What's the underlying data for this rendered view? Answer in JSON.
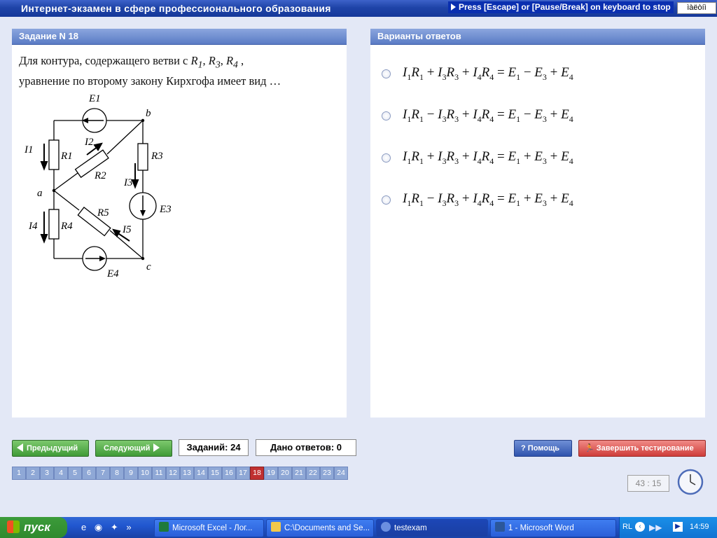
{
  "window": {
    "title": "Интернет-экзамен в сфере профессионального образования",
    "stop_hint": "Press [Escape] or [Pause/Break] on keyboard to stop",
    "lang_indicator": "ìàëòíì"
  },
  "task": {
    "header": "Задание N 18",
    "question_part1": "Для контура, содержащего ветви с",
    "question_part2": ",",
    "question_part3": "уравнение по второму закону Кирхгофа имеет вид …",
    "resistors": [
      "R1",
      "R3",
      "R4"
    ],
    "circuit_labels": {
      "E1": "E1",
      "b": "b",
      "I1": "I1",
      "R1": "R1",
      "I2": "I2",
      "R2": "R2",
      "R3": "R3",
      "I3": "I3",
      "a": "a",
      "E3": "E3",
      "R5": "R5",
      "I4": "I4",
      "R4": "R4",
      "I5": "I5",
      "c": "c",
      "E4": "E4"
    }
  },
  "answers": {
    "header": "Варианты ответов",
    "options": [
      {
        "formula": "I1R1 + I3R3 + I4R4 = E1 − E3 + E4",
        "selected": false
      },
      {
        "formula": "I1R1 − I3R3 + I4R4 = E1 − E3 + E4",
        "selected": false
      },
      {
        "formula": "I1R1 + I3R3 + I4R4 = E1 + E3 + E4",
        "selected": false
      },
      {
        "formula": "I1R1 − I3R3 + I4R4 = E1 + E3 + E4",
        "selected": false
      }
    ]
  },
  "nav": {
    "prev_label": "Предыдущий",
    "next_label": "Следующий",
    "tasks_count": "Заданий: 24",
    "answers_given": "Дано ответов: 0",
    "help_label": "Помощь",
    "finish_label": "Завершить тестирование",
    "numbers": [
      "1",
      "2",
      "3",
      "4",
      "5",
      "6",
      "7",
      "8",
      "9",
      "10",
      "11",
      "12",
      "13",
      "14",
      "15",
      "16",
      "17",
      "18",
      "19",
      "20",
      "21",
      "22",
      "23",
      "24"
    ],
    "current": "18",
    "timer": "43 : 15"
  },
  "taskbar": {
    "start_label": "пуск",
    "tasks": [
      {
        "label": "Microsoft Excel - Лог...",
        "icon": "excel-icon"
      },
      {
        "label": "C:\\Documents and Se...",
        "icon": "folder-icon"
      },
      {
        "label": "testexam",
        "icon": "app-icon"
      },
      {
        "label": "1 - Microsoft Word",
        "icon": "word-icon"
      }
    ],
    "lang": "RL",
    "clock": "14:59"
  },
  "colors": {
    "accent_blue": "#1f44a8",
    "green_button": "#3f9b37",
    "red_button": "#cf3d3a",
    "current_number": "#c03030"
  }
}
